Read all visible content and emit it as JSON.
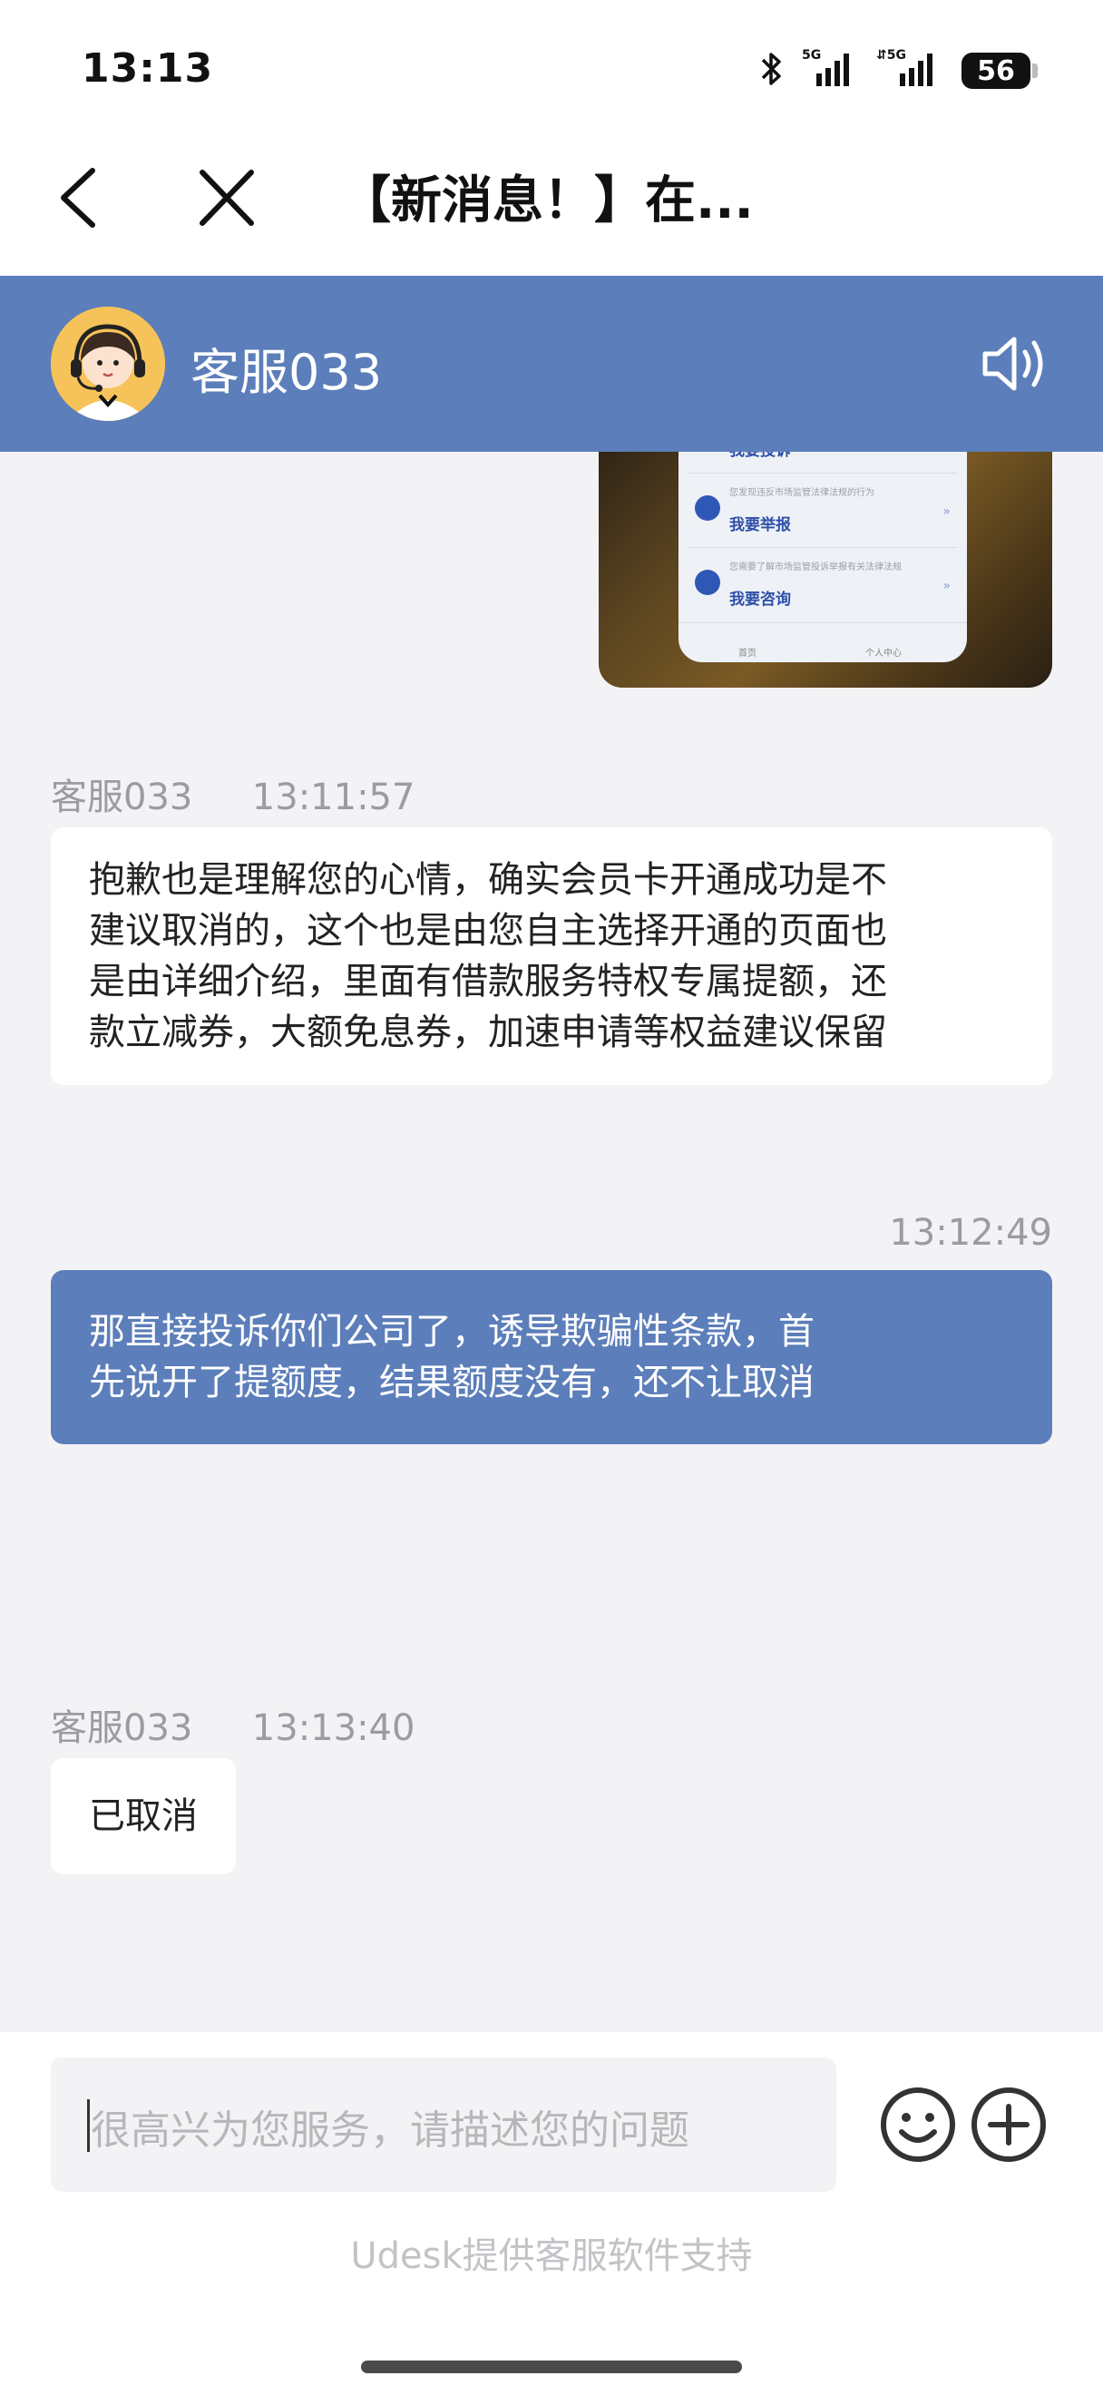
{
  "status_bar": {
    "time": "13:13",
    "battery": "56",
    "icons": [
      "bluetooth-icon",
      "5g-signal-icon",
      "5g-signal-icon"
    ]
  },
  "nav": {
    "title": "【新消息！】在...",
    "back_icon": "back-arrow-icon",
    "close_icon": "close-icon"
  },
  "agent": {
    "name": "客服033",
    "speaker_icon": "speaker-icon"
  },
  "image_message": {
    "rows": [
      {
        "sub": "",
        "main": "我要投诉"
      },
      {
        "sub": "您发现违反市场监管法律法规的行为",
        "main": "我要举报"
      },
      {
        "sub": "您需要了解市场监管投诉举报有关法律法规",
        "main": "我要咨询"
      }
    ],
    "tabs": [
      "首页",
      "个人中心"
    ]
  },
  "messages": [
    {
      "side": "left",
      "sender": "客服033",
      "time": "13:11:57",
      "lines": [
        "抱歉也是理解您的心情，确实会员卡开通成功是不",
        "建议取消的，这个也是由您自主选择开通的页面也",
        "是由详细介绍，里面有借款服务特权专属提额，还",
        "款立减券，大额免息券，加速申请等权益建议保留"
      ]
    },
    {
      "side": "right",
      "time": "13:12:49",
      "lines": [
        "那直接投诉你们公司了，诱导欺骗性条款，首",
        "先说开了提额度，结果额度没有，还不让取消"
      ]
    },
    {
      "side": "left",
      "sender": "客服033",
      "time": "13:13:40",
      "lines": [
        "已取消"
      ]
    }
  ],
  "input": {
    "placeholder": "很高兴为您服务，请描述您的问题",
    "emoji_icon": "emoji-icon",
    "plus_icon": "plus-icon"
  },
  "footer": {
    "powered_by": "Udesk提供客服软件支持"
  },
  "colors": {
    "brand": "#5c7eba",
    "background": "#f3f3f5",
    "bubble_left": "#ffffff"
  }
}
